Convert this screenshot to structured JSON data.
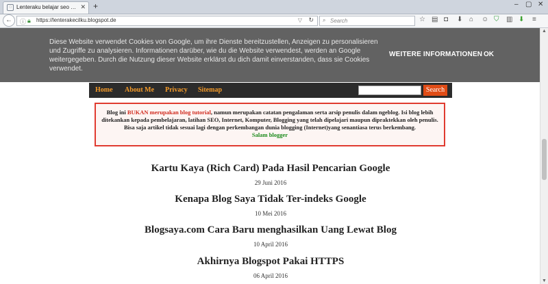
{
  "browser": {
    "tab_title": "Lenteraku belajar seo dan i...",
    "url": "https://lenterakecilku.blogspot.de",
    "search_placeholder": "Search"
  },
  "cookie_banner": {
    "text": "Diese Website verwendet Cookies von Google, um ihre Dienste bereitzustellen, Anzeigen zu personalisieren und Zugriffe zu analysieren. Informationen darüber, wie du die Website verwendest, werden an Google weitergegeben. Durch die Nutzung dieser Website erklärst du dich damit einverstanden, dass sie Cookies verwendet.",
    "more_label": "WEITERE INFORMATIONEN",
    "ok_label": "OK"
  },
  "blog_nav": {
    "items": [
      "Home",
      "About Me",
      "Privacy",
      "Sitemap"
    ],
    "search_button": "Search"
  },
  "notice": {
    "prefix": "Blog ini ",
    "highlight": "BUKAN merupakan blog tutorial",
    "body": ", namun merupakan catatan pengalaman serta arsip penulis dalam ngeblog. Isi blog lebih ditekankan kepada pembelajaran, latihan SEO, Internet, Komputer, Blogging yang telah dipelajari maupun dipraktekkan oleh penulis. Bisa saja artikel tidak sesuai lagi dengan perkembangan dunia blogging (Internet)yang senantiasa terus berkembang.",
    "signoff": "Salam blogger"
  },
  "posts": [
    {
      "title": "Kartu Kaya (Rich Card) Pada Hasil Pencarian Google",
      "date": "29 Juni 2016"
    },
    {
      "title": "Kenapa Blog Saya Tidak Ter-indeks Google",
      "date": "10 Mei 2016"
    },
    {
      "title": "Blogsaya.com Cara Baru menghasilkan Uang Lewat Blog",
      "date": "10 April 2016"
    },
    {
      "title": "Akhirnya Blogspot Pakai HTTPS",
      "date": "06 April 2016"
    }
  ],
  "colors": {
    "cookie_bg": "#626262",
    "nav_bg": "#2b2b2b",
    "nav_link": "#f59b29",
    "search_button": "#e04c16",
    "notice_border": "#e03a2f",
    "notice_highlight": "#d02b1f",
    "notice_signoff": "#1a8a1a"
  }
}
